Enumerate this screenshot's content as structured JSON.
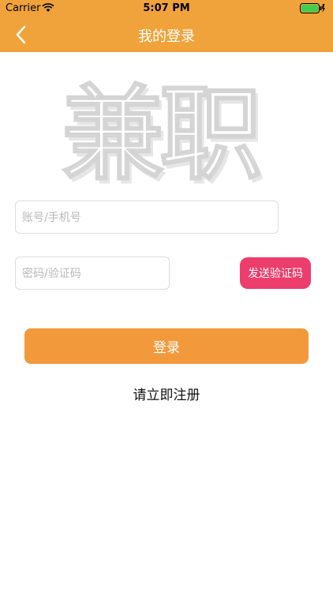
{
  "status_bar": {
    "carrier": "Carrier",
    "time": "5:07 PM"
  },
  "nav": {
    "title": "我的登录",
    "back_icon": "chevron-left-icon"
  },
  "logo": {
    "text": "兼职"
  },
  "form": {
    "account_placeholder": "账号/手机号",
    "password_placeholder": "密码/验证码",
    "send_code_label": "发送验证码",
    "login_label": "登录",
    "register_label": "请立即注册"
  },
  "colors": {
    "nav_bg": "#f0a33a",
    "login_button": "#f29a3b",
    "send_code_button": "#ec3d6c"
  }
}
